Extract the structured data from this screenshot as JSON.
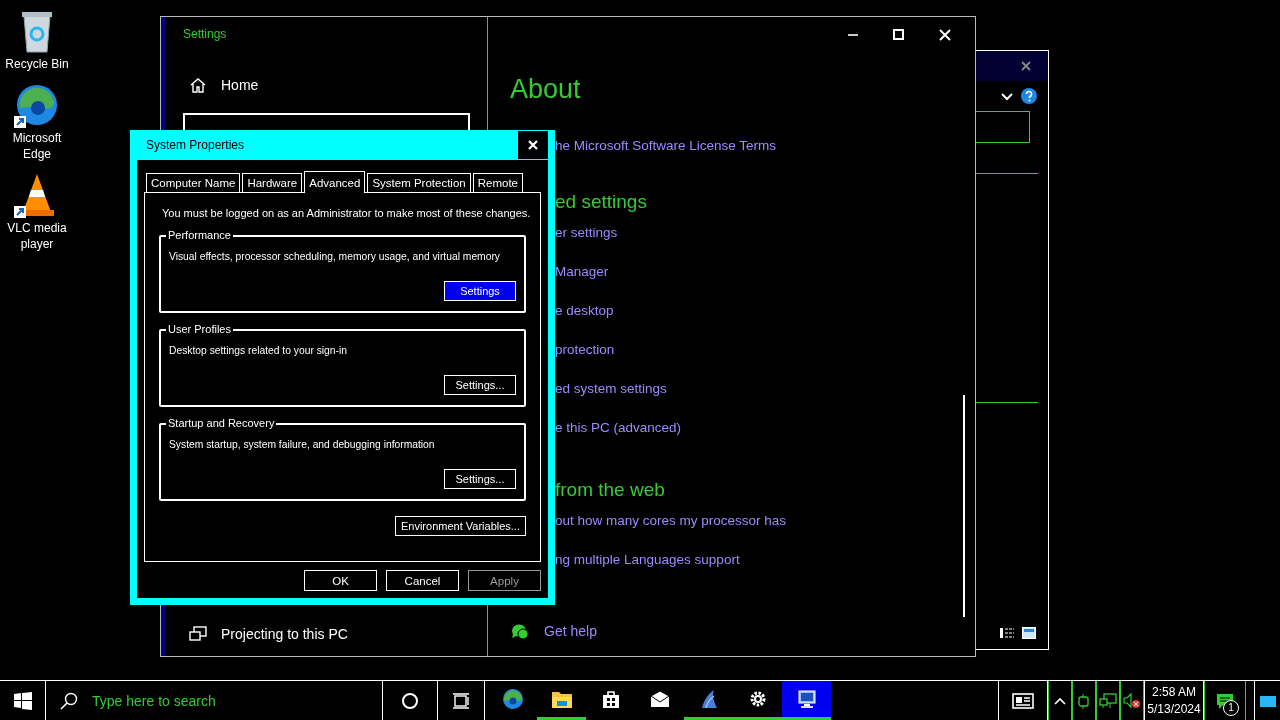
{
  "desktop_icons": [
    {
      "kind": "bin",
      "label": "Recycle Bin"
    },
    {
      "kind": "edge",
      "label": "Microsoft Edge"
    },
    {
      "kind": "vlc",
      "label": "VLC media player"
    }
  ],
  "settings_window": {
    "title": "Settings",
    "nav_top": {
      "label": "Home"
    },
    "nav_bottom": {
      "label": "Projecting to this PC"
    },
    "heading": "About",
    "content": [
      {
        "kind": "link",
        "text": "he Microsoft Software License Terms"
      },
      {
        "kind": "heading",
        "text": "ed settings"
      },
      {
        "kind": "link",
        "text": "er settings"
      },
      {
        "kind": "link",
        "text": "Manager"
      },
      {
        "kind": "link",
        "text": "e desktop"
      },
      {
        "kind": "link",
        "text": "protection"
      },
      {
        "kind": "link",
        "text": "ed system settings"
      },
      {
        "kind": "link",
        "text": "e this PC (advanced)"
      },
      {
        "kind": "heading",
        "text": "from the web"
      },
      {
        "kind": "link",
        "text": "out how many cores my processor has"
      },
      {
        "kind": "link",
        "text": "ng multiple Languages support"
      }
    ],
    "help": "Get help"
  },
  "dialog": {
    "title": "System Properties",
    "tabs": [
      {
        "label": "Computer Name",
        "selected": false
      },
      {
        "label": "Hardware",
        "selected": false
      },
      {
        "label": "Advanced",
        "selected": true
      },
      {
        "label": "System Protection",
        "selected": false
      },
      {
        "label": "Remote",
        "selected": false
      }
    ],
    "notice": "You must be logged on as an Administrator to make most of these changes.",
    "groups": [
      {
        "title": "Performance",
        "description": "Visual effects, processor scheduling, memory usage, and virtual memory",
        "button": "Settings",
        "focused": true
      },
      {
        "title": "User Profiles",
        "description": "Desktop settings related to your sign-in",
        "button": "Settings...",
        "focused": false
      },
      {
        "title": "Startup and Recovery",
        "description": "System startup, system failure, and debugging information",
        "button": "Settings...",
        "focused": false
      }
    ],
    "extra_button": "Environment Variables...",
    "buttons": [
      {
        "label": "OK",
        "disabled": false
      },
      {
        "label": "Cancel",
        "disabled": false
      },
      {
        "label": "Apply",
        "disabled": true
      }
    ]
  },
  "taskbar": {
    "search": {
      "placeholder": "Type here to search"
    },
    "apps": [
      {
        "kind": "edge",
        "running": false,
        "active": false
      },
      {
        "kind": "folder",
        "running": true,
        "active": false
      },
      {
        "kind": "store",
        "running": false,
        "active": false
      },
      {
        "kind": "mail",
        "running": false,
        "active": false
      },
      {
        "kind": "shark",
        "running": true,
        "active": false
      },
      {
        "kind": "gear",
        "running": true,
        "active": false
      },
      {
        "kind": "computer",
        "running": true,
        "active": true
      }
    ],
    "time": "2:58 AM",
    "date": "5/13/2024",
    "notifications": "1"
  }
}
